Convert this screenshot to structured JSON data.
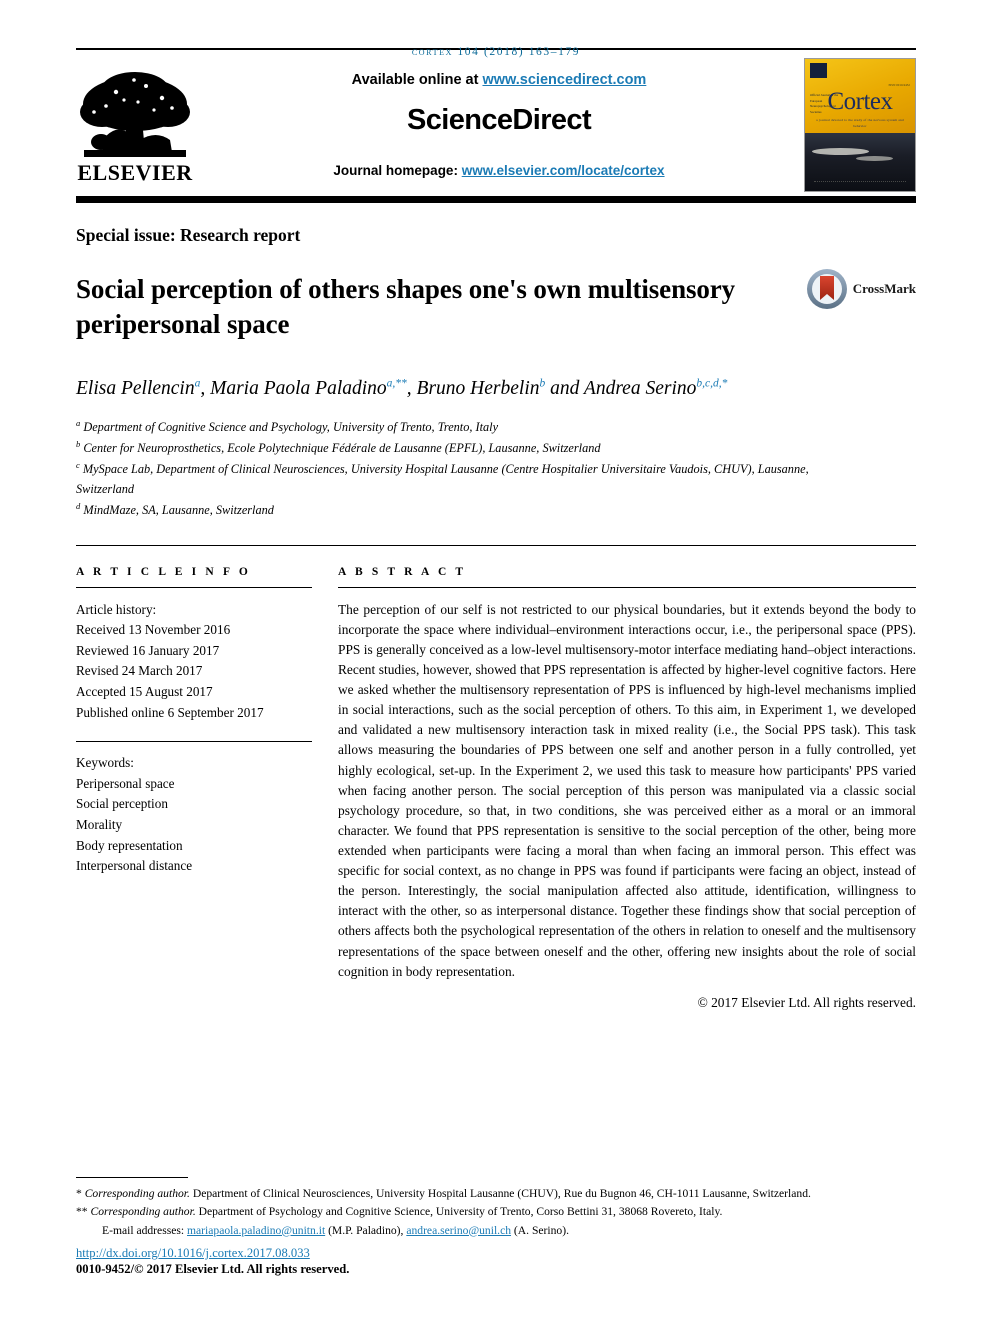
{
  "running_head": "cortex 104 (2018) 163–179",
  "masthead": {
    "available_prefix": "Available online at ",
    "sciencedirect_url": "www.sciencedirect.com",
    "brand": "ScienceDirect",
    "homepage_prefix": "Journal homepage: ",
    "homepage_url": "www.elsevier.com/locate/cortex",
    "publisher_logo_label": "ELSEVIER",
    "cover": {
      "journal_name": "Cortex",
      "subtitle": "a journal devoted to the study of the nervous system and behavior",
      "corner_note": "ISSN 0010-9452",
      "side_note": "Official Journal of the European Neuropsychological Societies"
    }
  },
  "article": {
    "section_label": "Special issue: Research report",
    "title": "Social perception of others shapes one's own multisensory peripersonal space",
    "crossmark_label": "CrossMark"
  },
  "authors": {
    "line1_parts": [
      {
        "name": "Elisa Pellencin",
        "sup": "a"
      },
      {
        "name": "Maria Paola Paladino",
        "sup": "a,**"
      },
      {
        "name": "Bruno Herbelin",
        "sup": "b"
      }
    ],
    "conjunction": " and ",
    "line2": {
      "name": "Andrea Serino",
      "sup": "b,c,d,*"
    }
  },
  "affiliations": [
    {
      "marker": "a",
      "text": "Department of Cognitive Science and Psychology, University of Trento, Trento, Italy"
    },
    {
      "marker": "b",
      "text": "Center for Neuroprosthetics, Ecole Polytechnique Fédérale de Lausanne (EPFL), Lausanne, Switzerland"
    },
    {
      "marker": "c",
      "text": "MySpace Lab, Department of Clinical Neurosciences, University Hospital Lausanne (Centre Hospitalier Universitaire Vaudois, CHUV), Lausanne, Switzerland"
    },
    {
      "marker": "d",
      "text": "MindMaze, SA, Lausanne, Switzerland"
    }
  ],
  "article_info": {
    "heading": "A R T I C L E  I N F O",
    "history_label": "Article history:",
    "history": [
      "Received 13 November 2016",
      "Reviewed 16 January 2017",
      "Revised 24 March 2017",
      "Accepted 15 August 2017",
      "Published online 6 September 2017"
    ],
    "keywords_label": "Keywords:",
    "keywords": [
      "Peripersonal space",
      "Social perception",
      "Morality",
      "Body representation",
      "Interpersonal distance"
    ]
  },
  "abstract": {
    "heading": "A B S T R A C T",
    "text": "The perception of our self is not restricted to our physical boundaries, but it extends beyond the body to incorporate the space where individual–environment interactions occur, i.e., the peripersonal space (PPS). PPS is generally conceived as a low-level multisensory-motor interface mediating hand–object interactions. Recent studies, however, showed that PPS representation is affected by higher-level cognitive factors. Here we asked whether the multisensory representation of PPS is influenced by high-level mechanisms implied in social interactions, such as the social perception of others. To this aim, in Experiment 1, we developed and validated a new multisensory interaction task in mixed reality (i.e., the Social PPS task). This task allows measuring the boundaries of PPS between one self and another person in a fully controlled, yet highly ecological, set-up. In the Experiment 2, we used this task to measure how participants' PPS varied when facing another person. The social perception of this person was manipulated via a classic social psychology procedure, so that, in two conditions, she was perceived either as a moral or an immoral character. We found that PPS representation is sensitive to the social perception of the other, being more extended when participants were facing a moral than when facing an immoral person. This effect was specific for social context, as no change in PPS was found if participants were facing an object, instead of the person. Interestingly, the social manipulation affected also attitude, identification, willingness to interact with the other, so as interpersonal distance. Together these findings show that social perception of others affects both the psychological representation of the others in relation to oneself and the multisensory representations of the space between oneself and the other, offering new insights about the role of social cognition in body representation.",
    "copyright": "© 2017 Elsevier Ltd. All rights reserved."
  },
  "footnotes": {
    "corresponding_1_marker": "*",
    "corresponding_1_label": "Corresponding author.",
    "corresponding_1_text": " Department of Clinical Neurosciences, University Hospital Lausanne (CHUV), Rue du Bugnon 46, CH-1011 Lausanne, Switzerland.",
    "corresponding_2_marker": "**",
    "corresponding_2_label": "Corresponding author.",
    "corresponding_2_text": " Department of Psychology and Cognitive Science, University of Trento, Corso Bettini 31, 38068 Rovereto, Italy.",
    "email_label": "E-mail addresses: ",
    "email_1": "mariapaola.paladino@unitn.it",
    "email_1_attr": " (M.P. Paladino), ",
    "email_2": "andrea.serino@unil.ch",
    "email_2_attr": " (A. Serino).",
    "doi": "http://dx.doi.org/10.1016/j.cortex.2017.08.033",
    "issn_line": "0010-9452/© 2017 Elsevier Ltd. All rights reserved."
  },
  "colors": {
    "link": "#1b7bb5",
    "runhead": "#0b6a98",
    "cover_gold": "#e8a800",
    "cover_navy": "#1c2d5e",
    "crossmark_red": "#c0392b"
  }
}
